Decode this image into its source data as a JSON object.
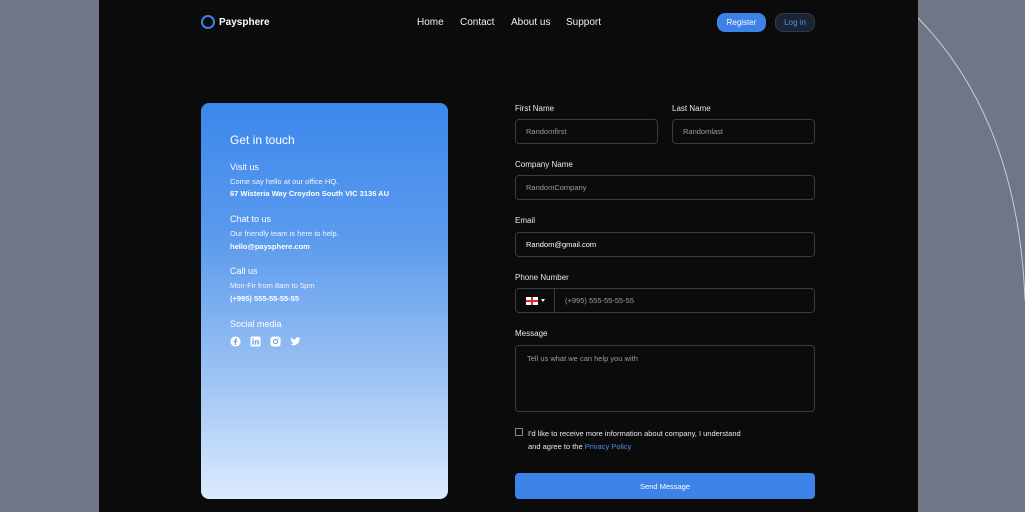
{
  "brand": {
    "name": "Paysphere",
    "accent": "#3d82e6"
  },
  "nav": {
    "items": [
      "Home",
      "Contact",
      "About us",
      "Support"
    ],
    "register": "Register",
    "login": "Log in"
  },
  "contact": {
    "title": "Get in touch",
    "visit": {
      "heading": "Visit us",
      "text": "Come say hello at our office HQ.",
      "detail": "67 Wisteria Way Croydon South VIC 3136 AU"
    },
    "chat": {
      "heading": "Chat to us",
      "text": "Our friendly team is here to help.",
      "detail": "hello@paysphere.com"
    },
    "call": {
      "heading": "Call us",
      "text": "Mon-Fir from 8am to 5pm",
      "detail": "(+995) 555-55-55-55"
    },
    "social": {
      "heading": "Social media",
      "icons": [
        "facebook-icon",
        "linkedin-icon",
        "instagram-icon",
        "twitter-icon"
      ]
    }
  },
  "form": {
    "first_name": {
      "label": "First Name",
      "value": "Randomfirst"
    },
    "last_name": {
      "label": "Last Name",
      "value": "Randomlast"
    },
    "company": {
      "label": "Company Name",
      "value": "RandomCompany"
    },
    "email": {
      "label": "Email",
      "value": "Random@gmail.com"
    },
    "phone": {
      "label": "Phone Number",
      "placeholder": "(+995) 555-55-55-55"
    },
    "message": {
      "label": "Message",
      "placeholder": "Tell us what we can help you with"
    },
    "consent": {
      "line1": "I'd like to receive more information about company, I understand",
      "line2": "and agree to the ",
      "link": "Privacy Policy",
      "checked": false
    },
    "submit": "Send Message"
  }
}
